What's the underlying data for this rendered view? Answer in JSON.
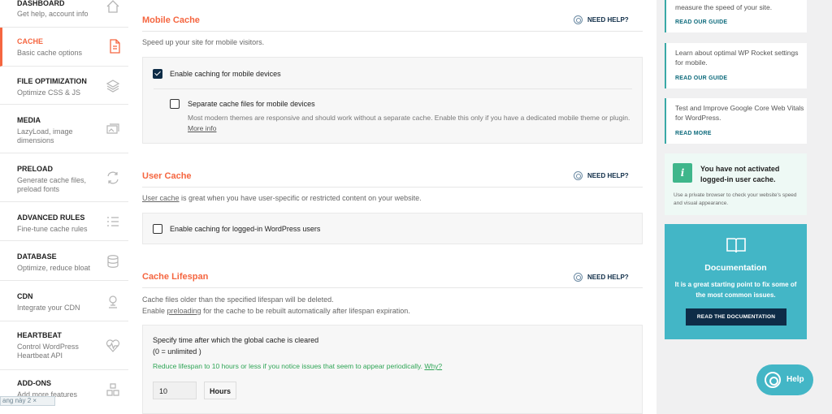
{
  "sidebar": {
    "items": [
      {
        "title": "DASHBOARD",
        "sub": "Get help, account info",
        "icon": "home-icon"
      },
      {
        "title": "CACHE",
        "sub": "Basic cache options",
        "icon": "file-icon"
      },
      {
        "title": "FILE OPTIMIZATION",
        "sub": "Optimize CSS & JS",
        "icon": "layers-icon"
      },
      {
        "title": "MEDIA",
        "sub": "LazyLoad, image dimensions",
        "icon": "images-icon"
      },
      {
        "title": "PRELOAD",
        "sub": "Generate cache files, preload fonts",
        "icon": "refresh-icon"
      },
      {
        "title": "ADVANCED RULES",
        "sub": "Fine-tune cache rules",
        "icon": "list-icon"
      },
      {
        "title": "DATABASE",
        "sub": "Optimize, reduce bloat",
        "icon": "database-icon"
      },
      {
        "title": "CDN",
        "sub": "Integrate your CDN",
        "icon": "cdn-icon"
      },
      {
        "title": "HEARTBEAT",
        "sub": "Control WordPress Heartbeat API",
        "icon": "heartbeat-icon"
      },
      {
        "title": "ADD-ONS",
        "sub": "Add more features",
        "icon": "addons-icon"
      }
    ],
    "fragment": "ang này  2 ×"
  },
  "mobile": {
    "title": "Mobile Cache",
    "help": "NEED HELP?",
    "desc": "Speed up your site for mobile visitors.",
    "opt1": "Enable caching for mobile devices",
    "opt2": "Separate cache files for mobile devices",
    "opt2_desc": "Most modern themes are responsive and should work without a separate cache. Enable this only if you have a dedicated mobile theme or plugin.",
    "opt2_link": "More info"
  },
  "user": {
    "title": "User Cache",
    "help": "NEED HELP?",
    "desc_link": "User cache",
    "desc_rest": " is great when you have user-specific or restricted content on your website.",
    "opt1": "Enable caching for logged-in WordPress users"
  },
  "lifespan": {
    "title": "Cache Lifespan",
    "help": "NEED HELP?",
    "desc1": "Cache files older than the specified lifespan will be deleted.",
    "desc2_pre": "Enable ",
    "desc2_link": "preloading",
    "desc2_post": " for the cache to be rebuilt automatically after lifespan expiration.",
    "box_title": "Specify time after which the global cache is cleared",
    "box_sub": "(0 = unlimited )",
    "tip": "Reduce lifespan to 10 hours or less if you notice issues that seem to appear periodically.",
    "tip_link": "Why?",
    "value": "10",
    "unit": "Hours"
  },
  "right": {
    "card1_text": "measure the speed of your site.",
    "card1_link": "READ OUR GUIDE",
    "card2_text": "Learn about optimal WP Rocket settings for mobile.",
    "card2_link": "READ OUR GUIDE",
    "card3_text": "Test and Improve Google Core Web Vitals for WordPress.",
    "card3_link": "READ MORE",
    "notice_badge": "i",
    "notice_title": "You have not activated logged-in user cache.",
    "notice_sub": "Use a private browser to check your website's speed and visual appearance.",
    "docs_title": "Documentation",
    "docs_desc": "It is a great starting point to fix some of the most common issues.",
    "docs_button": "READ THE DOCUMENTATION",
    "help_label": "Help"
  }
}
